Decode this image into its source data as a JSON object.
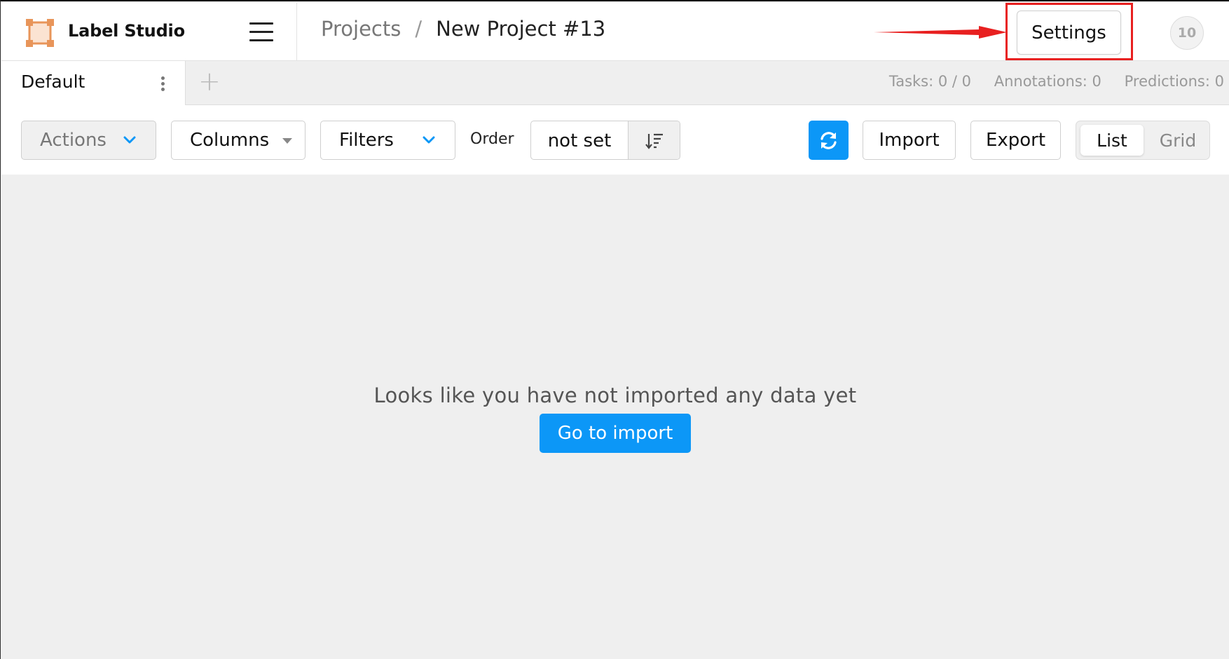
{
  "app": {
    "brand": "Label Studio",
    "accent_color": "#0c97f7",
    "logo_color": "#e8955a"
  },
  "header": {
    "breadcrumb": {
      "projects_label": "Projects",
      "separator": "/",
      "current": "New Project #13"
    },
    "settings_label": "Settings",
    "avatar_initials": "10",
    "annotation_color": "#e82020"
  },
  "tabs": {
    "items": [
      {
        "label": "Default",
        "active": true
      }
    ],
    "add_icon": "plus-icon",
    "stats": {
      "tasks": "Tasks: 0 / 0",
      "annotations": "Annotations: 0",
      "predictions": "Predictions: 0"
    }
  },
  "toolbar": {
    "actions_label": "Actions",
    "columns_label": "Columns",
    "filters_label": "Filters",
    "order_label": "Order",
    "order_value": "not set",
    "refresh_icon": "refresh-icon",
    "import_label": "Import",
    "export_label": "Export",
    "view_modes": {
      "list": "List",
      "grid": "Grid",
      "selected": "List"
    }
  },
  "empty_state": {
    "message": "Looks like you have not imported any data yet",
    "button_label": "Go to import"
  }
}
